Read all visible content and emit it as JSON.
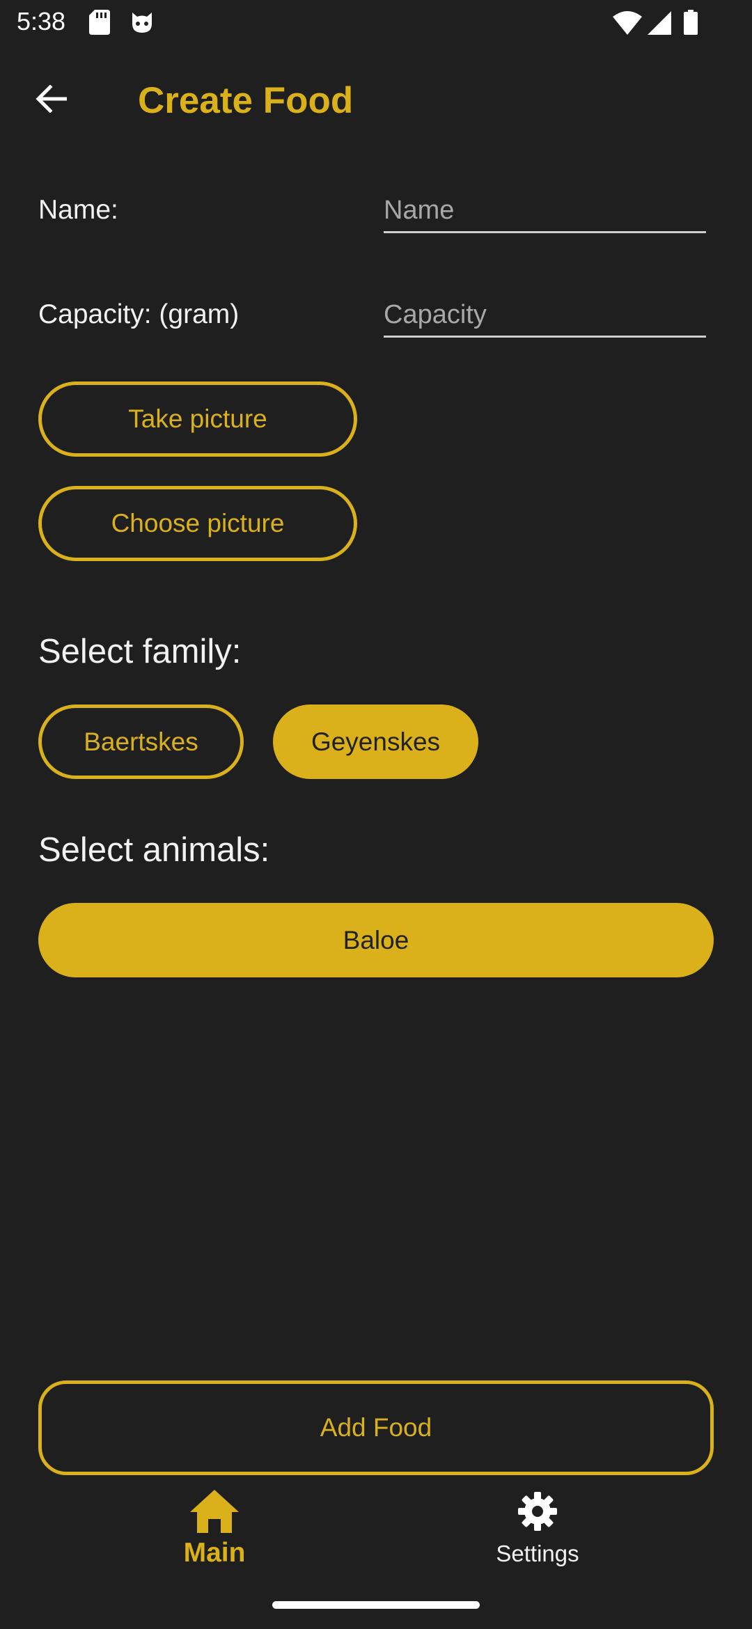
{
  "status_bar": {
    "time": "5:38",
    "icons": [
      "sd-card-icon",
      "cat-icon",
      "wifi-icon",
      "signal-icon",
      "battery-icon"
    ]
  },
  "app_bar": {
    "back_icon": "arrow-back-icon",
    "title": "Create Food"
  },
  "form": {
    "name": {
      "label": "Name:",
      "value": "",
      "placeholder": "Name"
    },
    "capacity": {
      "label": "Capacity: (gram)",
      "value": "",
      "placeholder": "Capacity"
    },
    "take_picture_label": "Take picture",
    "choose_picture_label": "Choose picture"
  },
  "family": {
    "heading": "Select family:",
    "options": [
      {
        "label": "Baertskes",
        "selected": false
      },
      {
        "label": "Geyenskes",
        "selected": true
      }
    ]
  },
  "animals": {
    "heading": "Select animals:",
    "options": [
      {
        "label": "Baloe",
        "selected": true
      }
    ]
  },
  "add_food_label": "Add Food",
  "bottom_nav": {
    "items": [
      {
        "label": "Main",
        "icon": "home-icon",
        "active": true
      },
      {
        "label": "Settings",
        "icon": "gear-icon",
        "active": false
      }
    ]
  },
  "colors": {
    "accent": "#dab11a",
    "background": "#1f1f1f",
    "text": "#f2f2f2"
  }
}
